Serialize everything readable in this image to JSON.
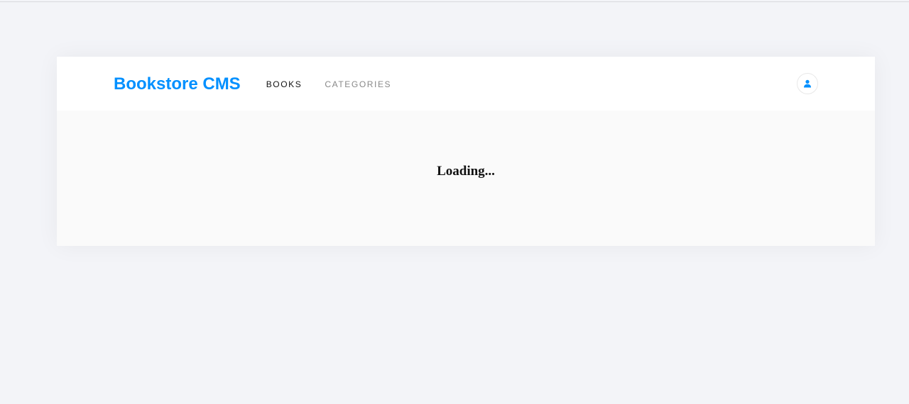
{
  "navbar": {
    "brand": "Bookstore CMS",
    "links": [
      {
        "label": "BOOKS",
        "active": true
      },
      {
        "label": "CATEGORIES",
        "active": false
      }
    ],
    "user_icon": "user-icon"
  },
  "main": {
    "status_text": "Loading..."
  },
  "colors": {
    "brand": "#0290ff",
    "background": "#f3f4f8",
    "card": "#fafafa",
    "nav_active": "#121212",
    "nav_inactive": "#888888"
  }
}
